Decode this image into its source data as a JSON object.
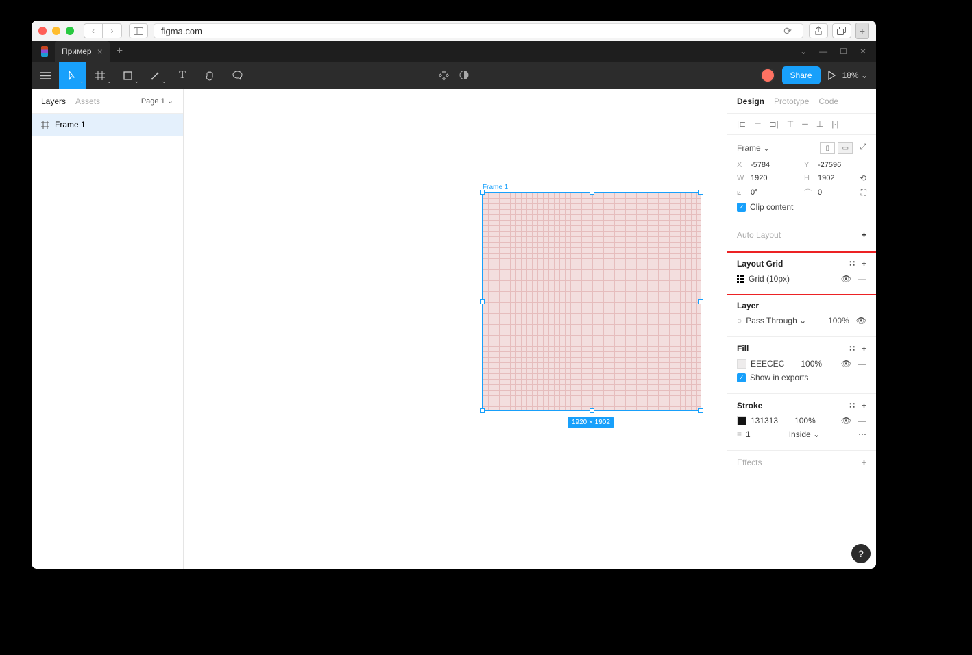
{
  "browser": {
    "url": "figma.com"
  },
  "tab": {
    "name": "Пример"
  },
  "toolbar": {
    "share": "Share",
    "zoom": "18%"
  },
  "left": {
    "tabs": {
      "layers": "Layers",
      "assets": "Assets"
    },
    "page_selector": "Page 1",
    "layer_name": "Frame 1"
  },
  "canvas": {
    "frame_label": "Frame 1",
    "size_badge": "1920 × 1902"
  },
  "right": {
    "tabs": {
      "design": "Design",
      "prototype": "Prototype",
      "code": "Code"
    },
    "frame": {
      "label": "Frame",
      "x_label": "X",
      "x": "-5784",
      "y_label": "Y",
      "y": "-27596",
      "w_label": "W",
      "w": "1920",
      "h_label": "H",
      "h": "1902",
      "rot": "0°",
      "radius": "0",
      "clip": "Clip content"
    },
    "auto_layout": "Auto Layout",
    "layout_grid": {
      "title": "Layout Grid",
      "item": "Grid (10px)"
    },
    "layer": {
      "title": "Layer",
      "blend": "Pass Through",
      "opacity": "100%"
    },
    "fill": {
      "title": "Fill",
      "hex": "EEECEC",
      "opacity": "100%",
      "show": "Show in exports"
    },
    "stroke": {
      "title": "Stroke",
      "hex": "131313",
      "opacity": "100%",
      "width": "1",
      "pos": "Inside"
    },
    "effects": "Effects"
  }
}
